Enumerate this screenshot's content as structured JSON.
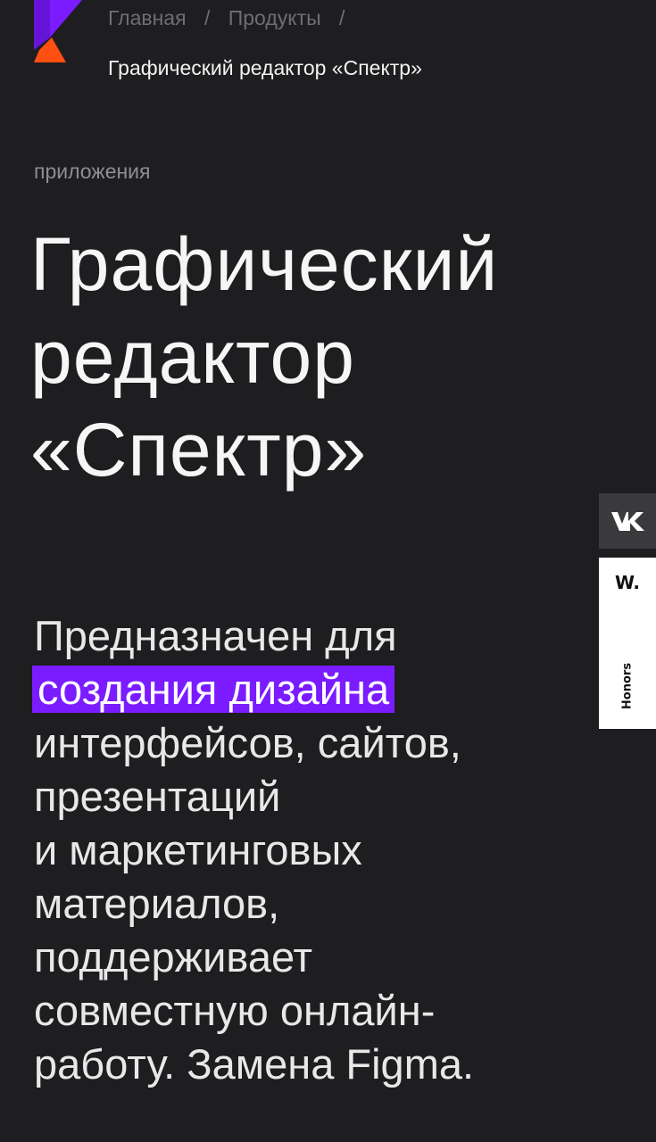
{
  "brand": {
    "logo_icon": "brand-logo-icon",
    "colors": {
      "logo_purple": "#7a1cff",
      "logo_orange": "#ff4f12",
      "highlight": "#7a1cff",
      "background": "#1e1d1f"
    }
  },
  "breadcrumb": {
    "items": [
      "Главная",
      "Продукты"
    ],
    "separator": "/",
    "current": "Графический редактор «Спектр»"
  },
  "category": "приложения",
  "title": {
    "lines": [
      "Графический",
      "редактор",
      "«Спектр»"
    ]
  },
  "description": {
    "before_highlight": "Предназначен для",
    "highlight": "создания дизайна",
    "after_lines": [
      "интерфейсов, сайтов,",
      "презентаций",
      "и маркетинговых",
      "материалов,",
      "поддерживает",
      "совместную онлайн-",
      "работу. Замена Figma."
    ]
  },
  "side_widget": {
    "vk_icon": "vk-icon",
    "honors_logo": "W.",
    "honors_label": "Honors"
  }
}
